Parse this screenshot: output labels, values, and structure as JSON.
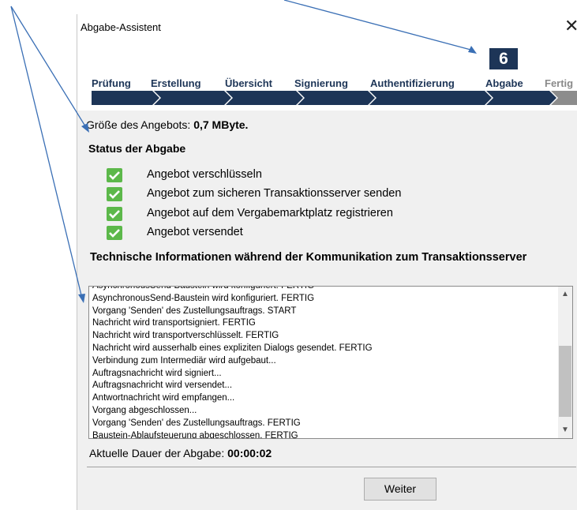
{
  "window": {
    "title": "Abgabe-Assistent",
    "close_glyph": "✕"
  },
  "wizard": {
    "current_step_number": "6",
    "steps": [
      {
        "label": "Prüfung",
        "state": "done"
      },
      {
        "label": "Erstellung",
        "state": "done"
      },
      {
        "label": "Übersicht",
        "state": "done"
      },
      {
        "label": "Signierung",
        "state": "done"
      },
      {
        "label": "Authentifizierung",
        "state": "done"
      },
      {
        "label": "Abgabe",
        "state": "current"
      },
      {
        "label": "Fertig",
        "state": "pending"
      }
    ],
    "colors": {
      "done": "#1d3557",
      "pending": "#8c8c8c"
    }
  },
  "offer_size": {
    "label": "Größe des Angebots: ",
    "value": "0,7 MByte."
  },
  "status": {
    "title": "Status der Abgabe",
    "items": [
      {
        "label": "Angebot verschlüsseln",
        "icon": "checkmark-icon"
      },
      {
        "label": "Angebot zum sicheren Transaktionsserver senden",
        "icon": "checkmark-icon"
      },
      {
        "label": "Angebot auf dem Vergabemarktplatz registrieren",
        "icon": "checkmark-icon"
      },
      {
        "label": "Angebot versendet",
        "icon": "checkmark-icon"
      }
    ],
    "check_color": "#5cb84a"
  },
  "tech_info": {
    "title": "Technische Informationen während der Kommunikation zum Transaktionsserver",
    "log_lines": [
      "AsynchronousSend-Baustein wird konfiguriert. FERTIG",
      "AsynchronousSend-Baustein wird konfiguriert. FERTIG",
      "Vorgang 'Senden' des Zustellungsauftrags. START",
      "Nachricht wird transportsigniert. FERTIG",
      "Nachricht wird transportverschlüsselt. FERTIG",
      "Nachricht wird ausserhalb eines expliziten Dialogs gesendet. FERTIG",
      "Verbindung zum Intermediär wird aufgebaut...",
      "Auftragsnachricht wird signiert...",
      "Auftragsnachricht wird versendet...",
      "Antwortnachricht wird empfangen...",
      "Vorgang abgeschlossen...",
      "Vorgang 'Senden' des Zustellungsauftrags. FERTIG",
      "Baustein-Ablaufsteuerung abgeschlossen. FERTIG"
    ]
  },
  "duration": {
    "label": "Aktuelle Dauer der Abgabe: ",
    "value": "00:00:02"
  },
  "buttons": {
    "next": "Weiter"
  },
  "annotation_color": "#3a6fb5"
}
